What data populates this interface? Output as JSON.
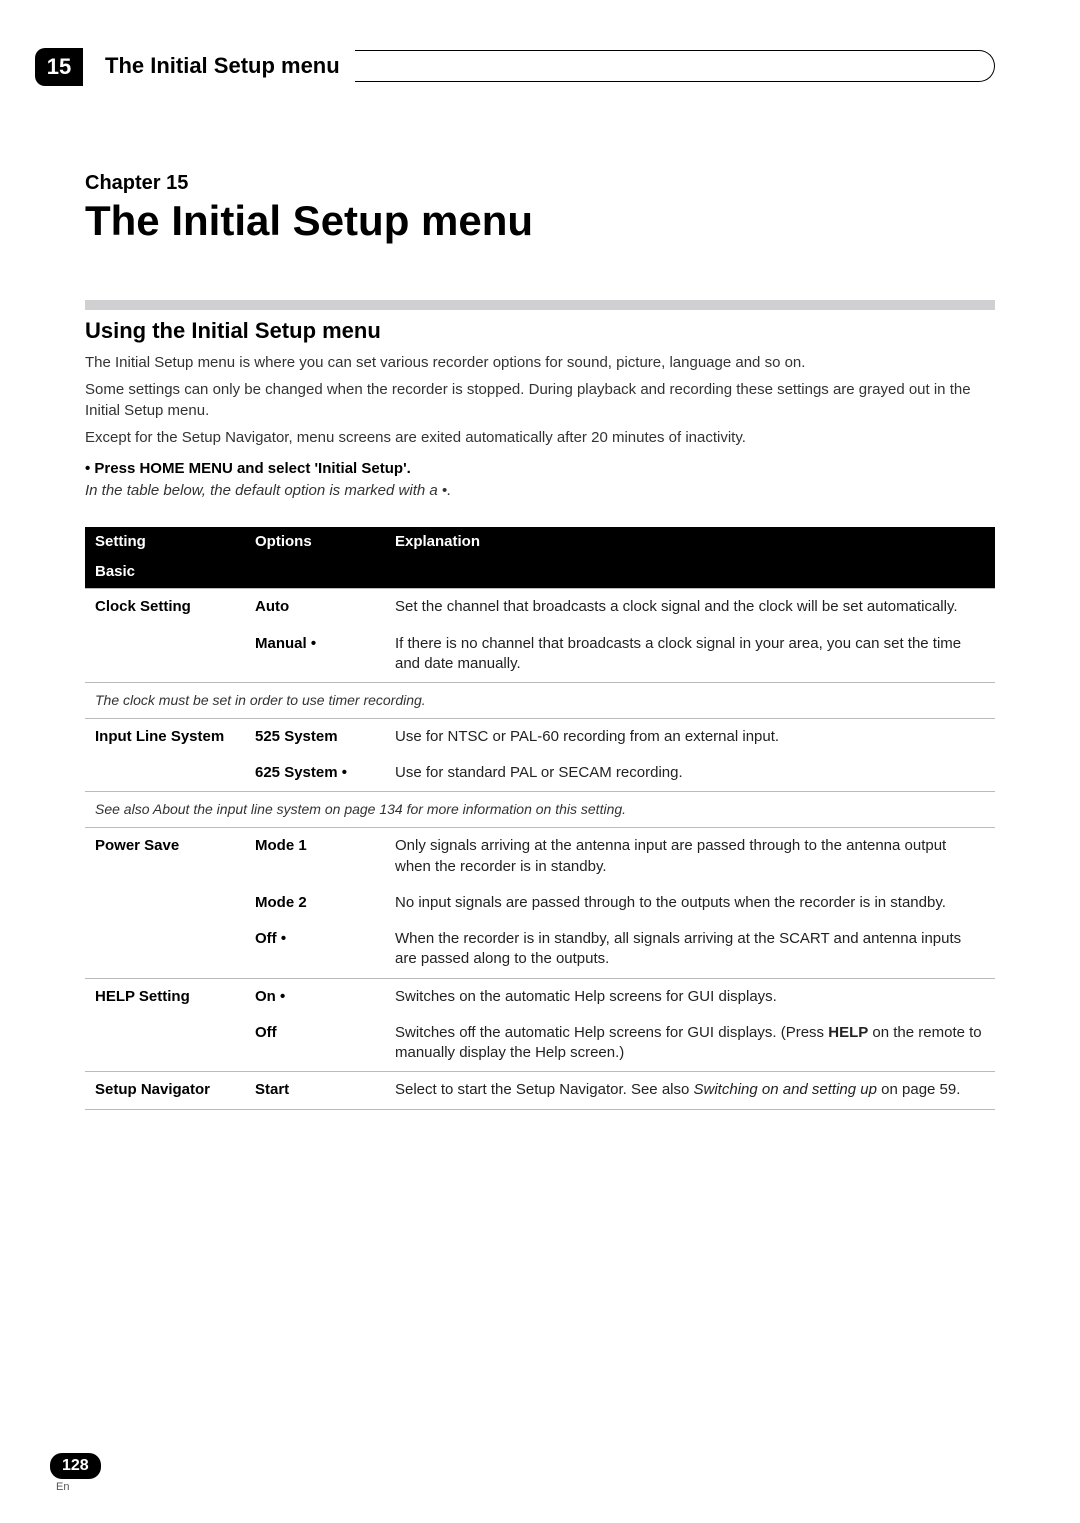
{
  "chapter_number": "15",
  "header_title": "The Initial Setup menu",
  "chapter_label": "Chapter 15",
  "main_title": "The Initial Setup menu",
  "section_heading": "Using the Initial Setup menu",
  "intro_p1": "The Initial Setup menu is where you can set various recorder options for sound, picture, language and so on.",
  "intro_p2": "Some settings can only be changed when the recorder is stopped. During playback and recording these settings are grayed out in the Initial Setup menu.",
  "intro_p3": "Except for the Setup Navigator, menu screens are exited automatically after 20 minutes of inactivity.",
  "bullet_prefix": "•   ",
  "bullet_instruction": "Press HOME MENU and select 'Initial Setup'.",
  "default_note_prefix": "In the table below, the default option is marked with a ",
  "default_note_bullet": "•",
  "default_note_suffix": ".",
  "table": {
    "headers": {
      "setting": "Setting",
      "options": "Options",
      "explanation": "Explanation"
    },
    "section_basic": "Basic",
    "rows": {
      "clock_setting_label": "Clock Setting",
      "clock_auto_option": "Auto",
      "clock_auto_expl": "Set the channel that broadcasts a clock signal and the clock will be set automatically.",
      "clock_manual_option": "Manual •",
      "clock_manual_expl": "If there is no channel that broadcasts a clock signal in your area, you can set the time and date manually.",
      "clock_note": "The clock must be set in order to use timer recording.",
      "input_line_label": "Input Line System",
      "input_525_option": "525 System",
      "input_525_expl": "Use for NTSC or PAL-60 recording from an external input.",
      "input_625_option": "625 System •",
      "input_625_expl": "Use for standard PAL or SECAM recording.",
      "input_note_prefix": "See also ",
      "input_note_italic": "About the input line system",
      "input_note_suffix": " on page 134 for more information on this setting.",
      "power_save_label": "Power Save",
      "power_mode1_option": "Mode 1",
      "power_mode1_expl": "Only signals arriving at the antenna input are passed through to the antenna output when the recorder is in standby.",
      "power_mode2_option": "Mode 2",
      "power_mode2_expl": "No input signals are passed through to the outputs when the recorder is in standby.",
      "power_off_option": "Off •",
      "power_off_expl": "When the recorder is in standby, all signals arriving at the SCART and antenna inputs are passed along to the outputs.",
      "help_label": "HELP Setting",
      "help_on_option": "On •",
      "help_on_expl": "Switches on the automatic Help screens for GUI displays.",
      "help_off_option": "Off",
      "help_off_expl_prefix": "Switches off the automatic Help screens for GUI displays. (Press ",
      "help_off_expl_bold": "HELP",
      "help_off_expl_suffix": " on the remote to manually display the Help screen.)",
      "setup_nav_label": "Setup Navigator",
      "setup_nav_option": "Start",
      "setup_nav_expl_prefix": "Select to start the Setup Navigator. See also ",
      "setup_nav_expl_italic": "Switching on and setting up",
      "setup_nav_expl_suffix": " on page 59."
    }
  },
  "page_number": "128",
  "page_lang": "En"
}
